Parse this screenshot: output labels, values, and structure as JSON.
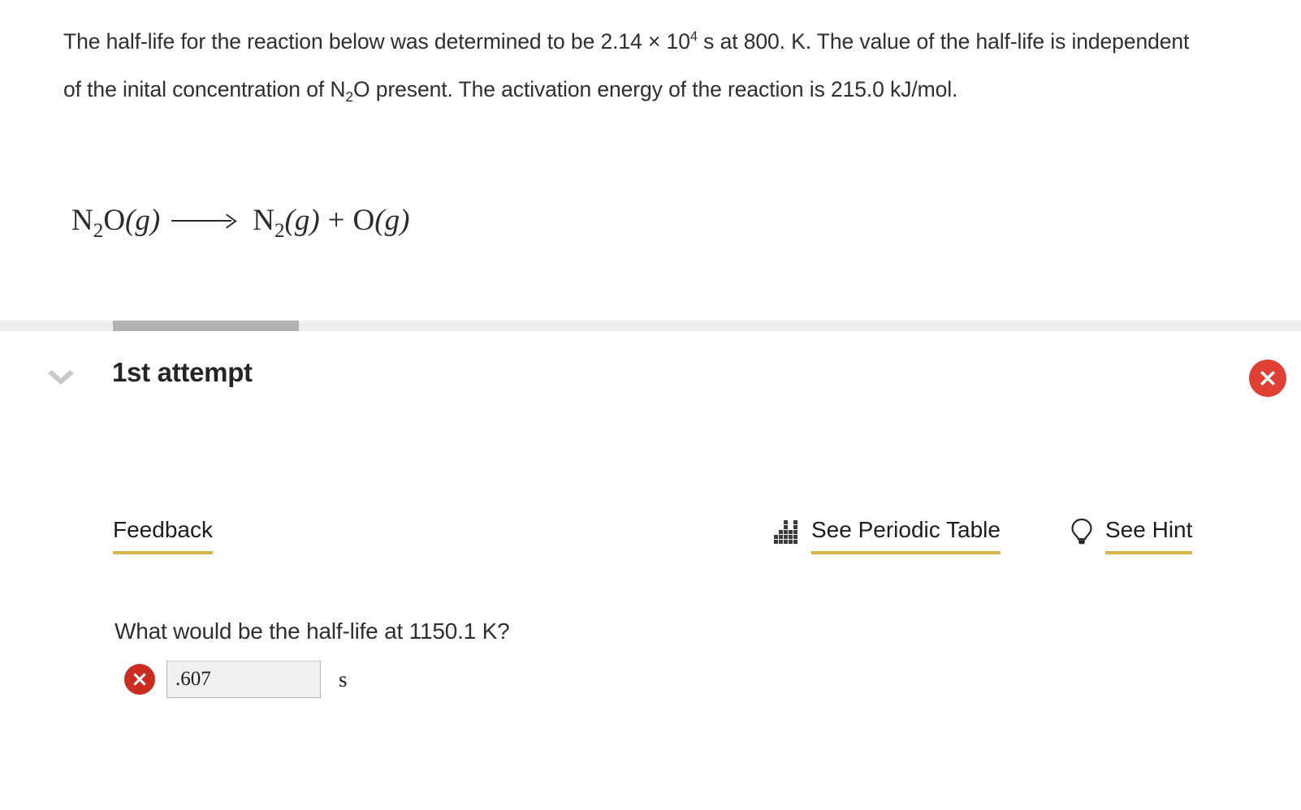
{
  "stem": {
    "line1_a": "The half-life for the reaction below was determined to be 2.14 × 10",
    "line1_sup": "4",
    "line1_b": " s at 800. K. The value of the half-life is independent of the inital concentration of N",
    "line1_sub": "2",
    "line1_c": "O present. The activation energy of the reaction is 215.0  kJ/mol."
  },
  "equation": {
    "reactant_element": "N",
    "reactant_sub": "2",
    "reactant_rest": "O",
    "reactant_state": "(g)",
    "product1_element": "N",
    "product1_sub": "2",
    "product1_state": "(g)",
    "plus": "+",
    "product2_element": "O",
    "product2_state": "(g)"
  },
  "attempt": {
    "title": "1st attempt",
    "collapse_icon": "chevron-down-icon",
    "status_icon": "error-circle-icon",
    "progress_percent": 14
  },
  "tabs": {
    "feedback_label": "Feedback"
  },
  "tools": [
    {
      "label": "See Periodic Table",
      "icon": "periodic-table-icon"
    },
    {
      "label": "See Hint",
      "icon": "lightbulb-icon"
    }
  ],
  "question": {
    "prompt": "What would be the half-life at 1150.1  K?",
    "answer_value": ".607",
    "answer_placeholder": "",
    "unit": "s",
    "status_icon": "error-circle-icon"
  },
  "colors": {
    "accent_underline": "#d8b44a",
    "error_red": "#e03f34",
    "error_red_dark": "#c92d21",
    "progress_track": "#eeeeee",
    "progress_fill": "#b2b2b2",
    "text": "#2f2f2f"
  }
}
